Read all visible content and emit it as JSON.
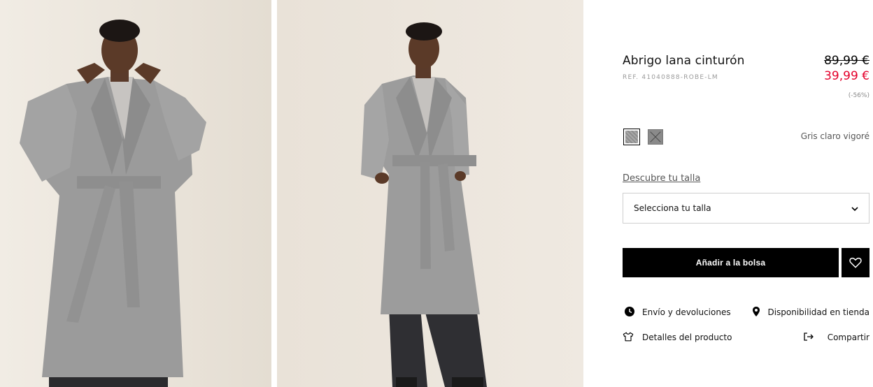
{
  "product": {
    "title": "Abrigo lana cinturón",
    "reference": "REF. 41040888-ROBE-LM",
    "price_original": "89,99 €",
    "price_sale": "39,99 €",
    "discount": "(-56%)"
  },
  "colors": {
    "selected_name": "Gris claro vigoré",
    "swatches": [
      {
        "name": "grey-vigore-swatch",
        "hex": "#9c9c9c"
      },
      {
        "name": "grey-unavailable-swatch",
        "hex": "#8a8a8a"
      }
    ]
  },
  "size": {
    "guide_link": "Descubre tu talla",
    "select_placeholder": "Selecciona tu talla"
  },
  "buttons": {
    "add_to_bag": "Añadir a la bolsa"
  },
  "actions": {
    "shipping": "Envío y devoluciones",
    "availability": "Disponibilidad en tienda",
    "details": "Detalles del producto",
    "share": "Compartir"
  },
  "icons": {
    "shipping": "clock-icon",
    "availability": "location-pin-icon",
    "details": "tshirt-icon",
    "share": "share-icon",
    "favorite": "heart-icon",
    "dropdown": "chevron-down-icon"
  },
  "colors_theme": {
    "sale": "#e4002b",
    "primary_button": "#000000",
    "background": "#ffffff"
  }
}
